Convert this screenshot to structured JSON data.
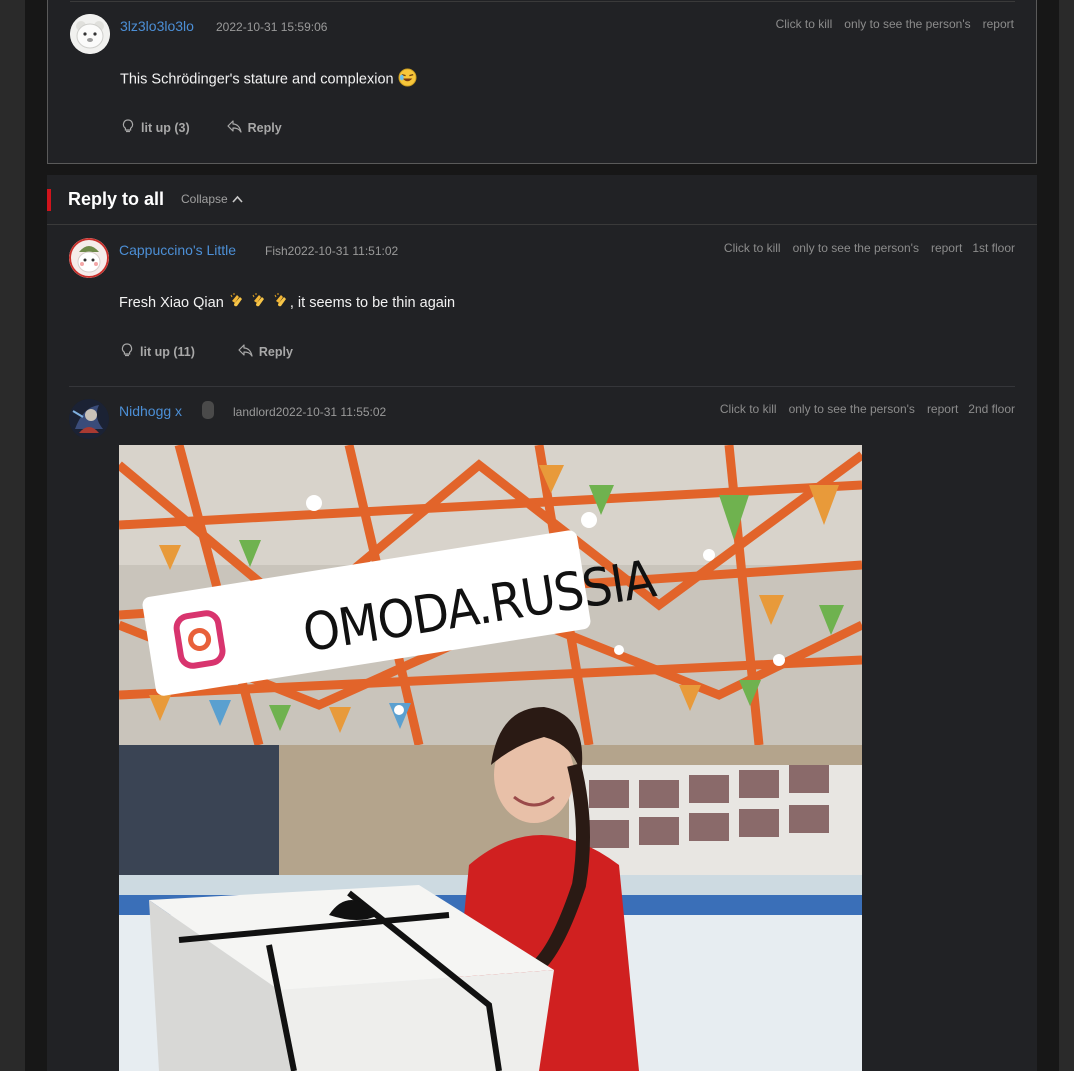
{
  "top_comment": {
    "username": "3lz3lo3lo3lo",
    "timestamp": "2022-10-31 15:59:06",
    "actions": [
      "Click to kill",
      "only to see the person's",
      "report"
    ],
    "text": "This Schrödinger's stature and complexion",
    "lit_up": "lit up (3)",
    "reply": "Reply"
  },
  "reply_section": {
    "title": "Reply to all",
    "collapse": "Collapse"
  },
  "comments": [
    {
      "username": "Cappuccino's Little",
      "meta": "Fish2022-10-31 11:51:02",
      "actions": [
        "Click to kill",
        "only to see the person's",
        "report",
        "1st floor"
      ],
      "text": "Fresh Xiao Qian",
      "text_suffix": ", it seems to be thin again",
      "lit_up": "lit up (11)",
      "reply": "Reply"
    },
    {
      "username": "Nidhogg x",
      "meta": "landlord2022-10-31 11:55:02",
      "actions": [
        "Click to kill",
        "only to see the person's",
        "report",
        "2nd floor"
      ],
      "image_sign_text": "OMODA.RUSSIA"
    }
  ],
  "colors": {
    "accent_red": "#d0141c",
    "username_blue": "#4c8fd6",
    "panel_bg": "#212225"
  }
}
